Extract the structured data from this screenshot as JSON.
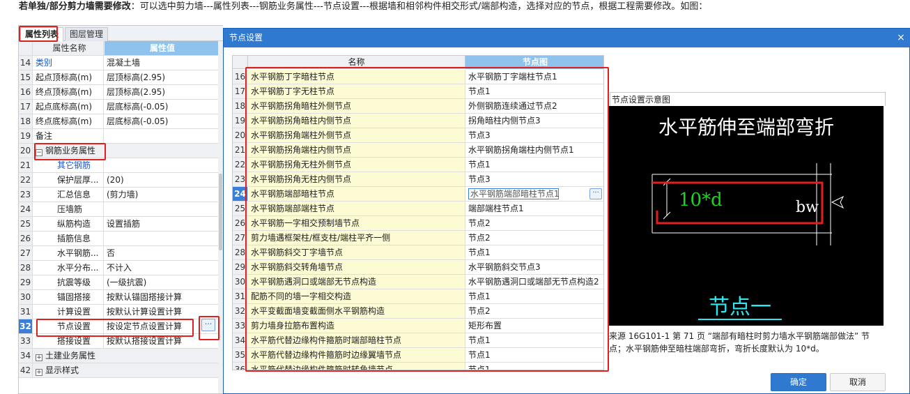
{
  "intro": {
    "bold": "若单独/部分剪力墙需要修改",
    "rest": "：可以选中剪力墙---属性列表---钢筋业务属性---节点设置---根据墙和相邻构件相交形式/端部构造，选择对应的节点，根据工程需要修改。如图："
  },
  "left_panel": {
    "tabs": [
      "属性列表",
      "图层管理"
    ],
    "header": {
      "name": "属性名称",
      "value": "属性值"
    },
    "rows": [
      {
        "num": "14",
        "name": "类别",
        "value": "混凝土墙"
      },
      {
        "num": "15",
        "name": "起点顶标高(m)",
        "value": "层顶标高(2.95)"
      },
      {
        "num": "16",
        "name": "终点顶标高(m)",
        "value": "层顶标高(2.95)"
      },
      {
        "num": "17",
        "name": "起点底标高(m)",
        "value": "层底标高(-0.05)"
      },
      {
        "num": "18",
        "name": "终点底标高(m)",
        "value": "层底标高(-0.05)"
      },
      {
        "num": "19",
        "name": "备注",
        "value": ""
      },
      {
        "num": "20",
        "name": "钢筋业务属性",
        "value": ""
      },
      {
        "num": "21",
        "name": "其它钢筋",
        "value": ""
      },
      {
        "num": "22",
        "name": "保护层厚...",
        "value": "(20)"
      },
      {
        "num": "23",
        "name": "汇总信息",
        "value": "(剪力墙)"
      },
      {
        "num": "24",
        "name": "压墙筋",
        "value": ""
      },
      {
        "num": "25",
        "name": "纵筋构造",
        "value": "设置插筋"
      },
      {
        "num": "26",
        "name": "插筋信息",
        "value": ""
      },
      {
        "num": "27",
        "name": "水平钢筋...",
        "value": "否"
      },
      {
        "num": "28",
        "name": "水平分布...",
        "value": "不计入"
      },
      {
        "num": "29",
        "name": "抗震等级",
        "value": "(一级抗震)"
      },
      {
        "num": "30",
        "name": "锚固搭接",
        "value": "按默认锚固搭接计算"
      },
      {
        "num": "31",
        "name": "计算设置",
        "value": "按默认计算设置计算"
      },
      {
        "num": "32",
        "name": "节点设置",
        "value": "按设定节点设置计算"
      },
      {
        "num": "33",
        "name": "搭接设置",
        "value": "按默认搭接设置计算"
      },
      {
        "num": "34",
        "name": "土建业务属性",
        "value": ""
      },
      {
        "num": "42",
        "name": "显示样式",
        "value": ""
      }
    ],
    "more_button": "···"
  },
  "dialog": {
    "title": "节点设置",
    "close": "×",
    "grid_header": {
      "name": "名称",
      "node": "节点图"
    },
    "rows": [
      {
        "num": "16",
        "name": "水平钢筋丁字暗柱节点",
        "node": "水平钢筋丁字端柱节点1"
      },
      {
        "num": "17",
        "name": "水平钢筋丁字无柱节点",
        "node": "节点1"
      },
      {
        "num": "18",
        "name": "水平钢筋拐角暗柱外侧节点",
        "node": "外侧钢筋连续通过节点2"
      },
      {
        "num": "19",
        "name": "水平钢筋拐角暗柱内侧节点",
        "node": "拐角暗柱内侧节点3"
      },
      {
        "num": "20",
        "name": "水平钢筋拐角端柱外侧节点",
        "node": "节点3"
      },
      {
        "num": "21",
        "name": "水平钢筋拐角端柱内侧节点",
        "node": "水平钢筋拐角端柱内侧节点1"
      },
      {
        "num": "22",
        "name": "水平钢筋拐角无柱外侧节点",
        "node": "节点1"
      },
      {
        "num": "23",
        "name": "水平钢筋拐角无柱内侧节点",
        "node": "节点3"
      },
      {
        "num": "24",
        "name": "水平钢筋端部暗柱节点",
        "node": "水平钢筋端部暗柱节点1"
      },
      {
        "num": "25",
        "name": "水平钢筋端部端柱节点",
        "node": "端部端柱节点1"
      },
      {
        "num": "26",
        "name": "水平钢筋一字相交预制墙节点",
        "node": "节点2"
      },
      {
        "num": "27",
        "name": "剪力墙遇框架柱/框支柱/端柱平齐一侧",
        "node": "节点2"
      },
      {
        "num": "28",
        "name": "水平钢筋斜交丁字墙节点",
        "node": "节点1"
      },
      {
        "num": "29",
        "name": "水平钢筋斜交转角墙节点",
        "node": "水平钢筋斜交节点3"
      },
      {
        "num": "30",
        "name": "水平钢筋遇洞口或端部无节点构造",
        "node": "水平钢筋遇洞口或端部无节点构造2"
      },
      {
        "num": "31",
        "name": "配筋不同的墙一字相交构造",
        "node": "节点1"
      },
      {
        "num": "32",
        "name": "水平变截面墙变截面侧水平钢筋构造",
        "node": "节点2"
      },
      {
        "num": "33",
        "name": "剪力墙身拉筋布置构造",
        "node": "矩形布置"
      },
      {
        "num": "34",
        "name": "水平筋代替边缘构件箍筋时端部暗柱节点",
        "node": "节点1"
      },
      {
        "num": "35",
        "name": "水平筋代替边缘构件箍筋时边缘翼墙节点",
        "node": "节点1"
      },
      {
        "num": "36",
        "name": "水平筋代替边缘构件箍筋时转角墙节点",
        "node": "节点1"
      }
    ],
    "edit_button": "···",
    "preview": {
      "label": "节点设置示意图",
      "heading": "水平筋伸至端部弯折",
      "dim_text": "10*d",
      "bw_text": "bw",
      "caption": "节点一",
      "description": "来源 16G101-1 第 71 页 “端部有暗柱时剪力墙水平钢筋端部做法” 节点；水平钢筋伸至暗柱端部弯折，弯折长度默认为 10*d。"
    },
    "ok": "确定",
    "cancel": "取消"
  },
  "colors": {
    "accent": "#2f79d1",
    "header_value": "#8fc3ee",
    "name_cell": "#fdfbd3",
    "highlight": "#e02020",
    "preview_bg": "#000000",
    "preview_green": "#21d321",
    "preview_cyan": "#2ee6f0"
  }
}
